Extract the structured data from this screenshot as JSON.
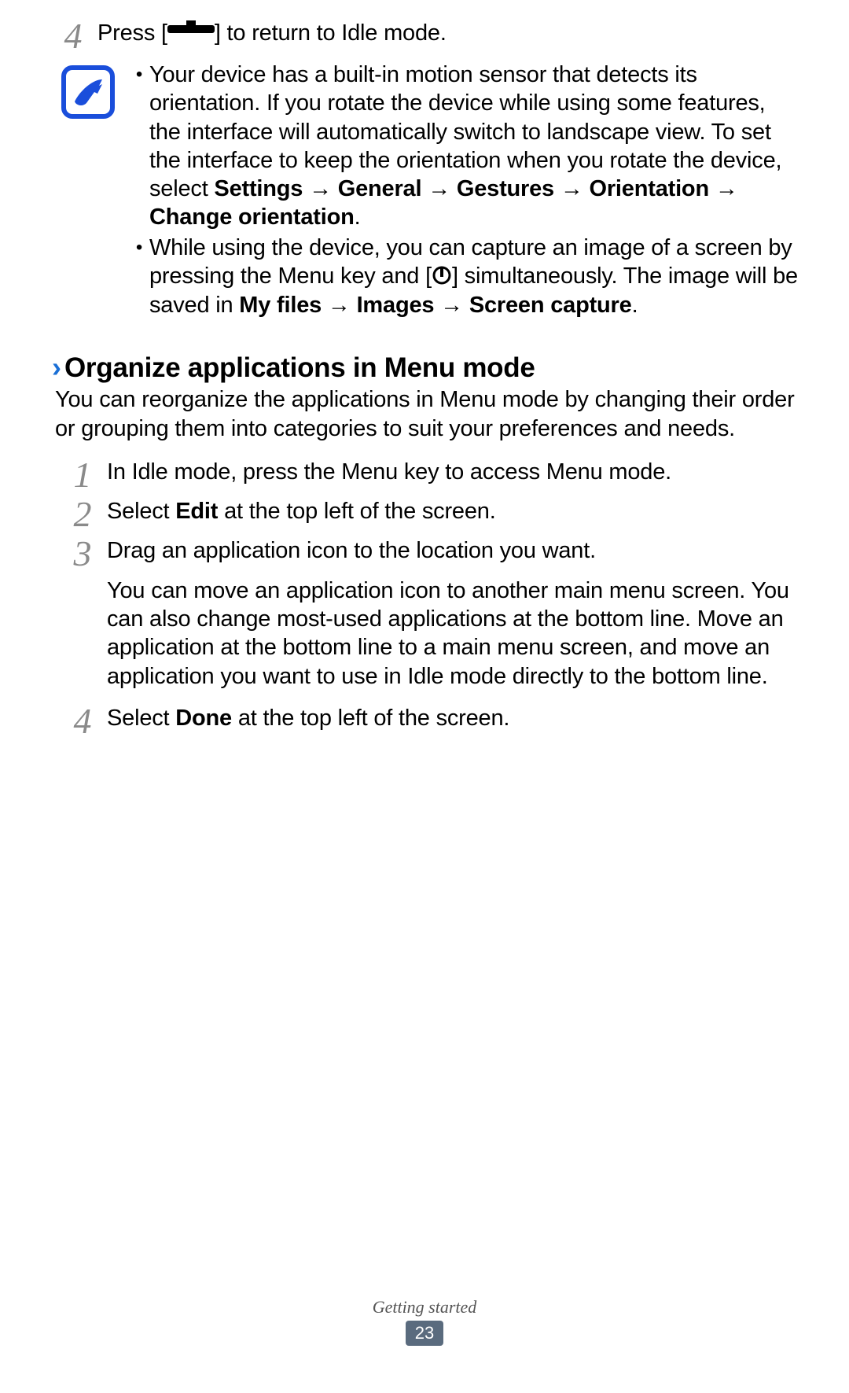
{
  "step4_top": {
    "num": "4",
    "before": "Press [",
    "after": "] to return to Idle mode."
  },
  "note": {
    "item1": {
      "text_a": "Your device has a built-in motion sensor that detects its orientation. If you rotate the device while using some features, the interface will automatically switch to landscape view. To set the interface to keep the orientation when you rotate the device, select ",
      "bold_a": "Settings → General → Gestures → Orientation → Change orientation",
      "text_b": "."
    },
    "item2": {
      "text_a": "While using the device, you can capture an image of a screen by pressing the Menu key and [",
      "text_b": "] simultaneously. The image will be saved in ",
      "bold_a": "My files → Images → Screen capture",
      "text_c": "."
    }
  },
  "heading": "Organize applications in Menu mode",
  "intro": "You can reorganize the applications in Menu mode by changing their order or grouping them into categories to suit your preferences and needs.",
  "steps": {
    "s1": {
      "num": "1",
      "text": "In Idle mode, press the Menu key to access Menu mode."
    },
    "s2": {
      "num": "2",
      "pre": "Select ",
      "bold": "Edit",
      "post": " at the top left of the screen."
    },
    "s3": {
      "num": "3",
      "line": "Drag an application icon to the location you want.",
      "para": "You can move an application icon to another main menu screen. You can also change most-used applications at the bottom line. Move an application at the bottom line to a main menu screen, and move an application you want to use in Idle mode directly to the bottom line."
    },
    "s4": {
      "num": "4",
      "pre": "Select ",
      "bold": "Done",
      "post": " at the top left of the screen."
    }
  },
  "footer": {
    "section": "Getting started",
    "page": "23"
  }
}
